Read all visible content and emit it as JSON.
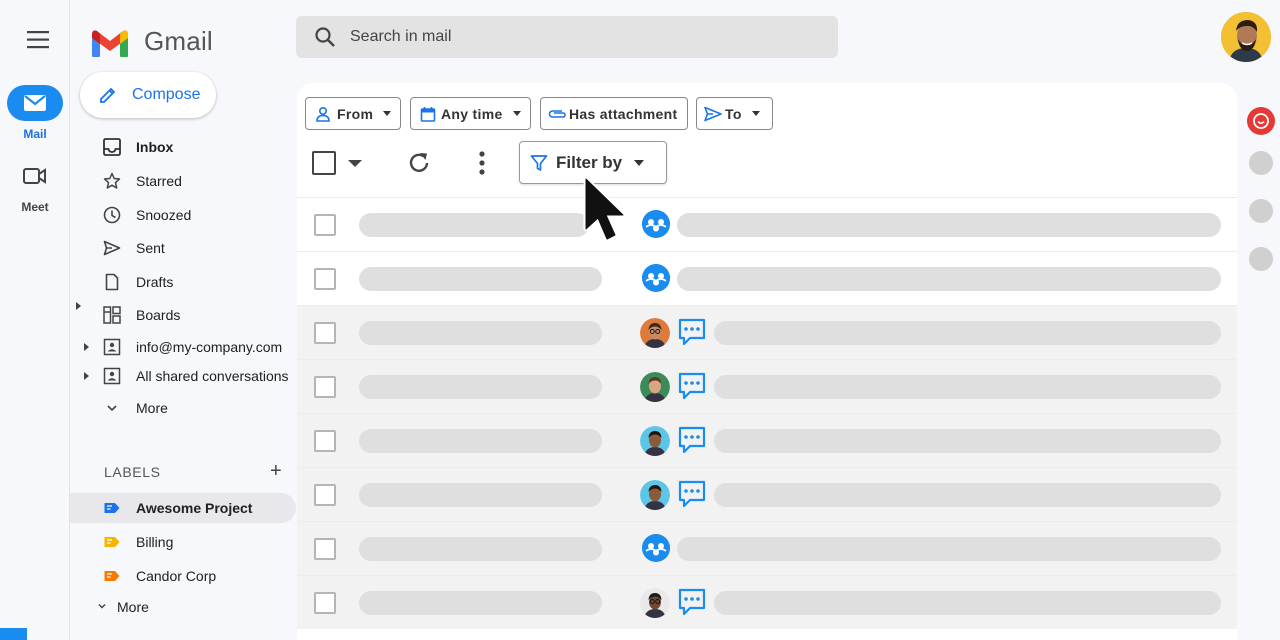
{
  "app": {
    "name": "Gmail"
  },
  "rail": {
    "items": [
      {
        "label": "Mail",
        "icon": "mail-icon"
      },
      {
        "label": "Meet",
        "icon": "video-icon"
      }
    ]
  },
  "sidebar": {
    "compose_label": "Compose",
    "items": [
      {
        "label": "Inbox",
        "icon": "inbox-icon",
        "bold": true
      },
      {
        "label": "Starred",
        "icon": "star-icon"
      },
      {
        "label": "Snoozed",
        "icon": "clock-icon"
      },
      {
        "label": "Sent",
        "icon": "send-icon"
      },
      {
        "label": "Drafts",
        "icon": "draft-icon"
      },
      {
        "label": "Boards",
        "icon": "boards-icon"
      },
      {
        "label": "info@my-company.com",
        "icon": "shared-inbox-icon"
      },
      {
        "label": "All shared conversations",
        "icon": "shared-inbox-icon"
      },
      {
        "label": "More",
        "icon": "chevron-down-icon"
      }
    ],
    "labels_heading": "LABELS",
    "labels": [
      {
        "label": "Awesome Project",
        "color": "#1a73e8",
        "selected": true
      },
      {
        "label": "Billing",
        "color": "#f4b400"
      },
      {
        "label": "Candor Corp",
        "color": "#f57c00"
      }
    ],
    "labels_more": "More"
  },
  "search": {
    "placeholder": "Search in mail"
  },
  "filters": {
    "chips": [
      {
        "label": "From",
        "icon": "person-icon"
      },
      {
        "label": "Any time",
        "icon": "calendar-icon"
      },
      {
        "label": "Has attachment",
        "icon": "paperclip-icon"
      },
      {
        "label": "To",
        "icon": "send-icon"
      }
    ],
    "filter_by_label": "Filter by"
  },
  "colors": {
    "accent": "#1a8cf0",
    "brand_red": "#ea4335"
  },
  "email_rows": [
    {
      "type": "group"
    },
    {
      "type": "group"
    },
    {
      "type": "person-chat",
      "avatar": "man-glasses"
    },
    {
      "type": "person-chat",
      "avatar": "woman-long-hair"
    },
    {
      "type": "person-chat",
      "avatar": "woman-curly-hair"
    },
    {
      "type": "person-chat",
      "avatar": "woman-curly-hair"
    },
    {
      "type": "group"
    },
    {
      "type": "person-chat",
      "avatar": "man-glasses-dark"
    }
  ]
}
